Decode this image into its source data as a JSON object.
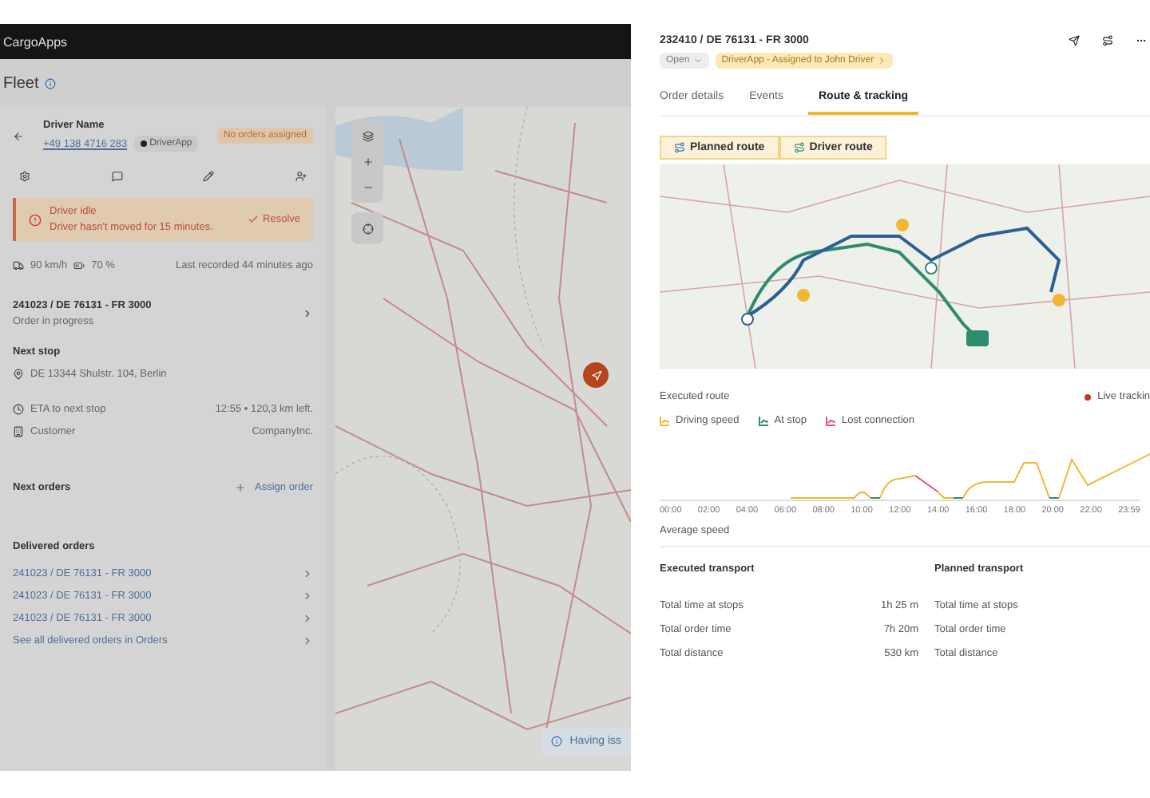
{
  "app": {
    "logo": "CargoApps",
    "page_title": "Fleet"
  },
  "driver": {
    "name": "Driver Name",
    "phone": "+49 138 4716 283",
    "app_badge": "DriverApp",
    "status_badge": "No orders assigned"
  },
  "alert": {
    "title": "Driver idle",
    "message": "Driver hasn't moved for 15 minutes.",
    "action": "Resolve"
  },
  "stats": {
    "speed": "90 km/h",
    "battery": "70 %",
    "last_recorded": "Last recorded 44 minutes ago"
  },
  "current_order": {
    "title": "241023 / DE 76131 - FR 3000",
    "status": "Order in progress"
  },
  "next_stop": {
    "heading": "Next stop",
    "address": "DE 13344 Shulstr. 104, Berlin",
    "details": [
      {
        "kind": "eta",
        "label": "ETA to next stop",
        "value": "12:55 • 120,3 km left."
      },
      {
        "kind": "customer",
        "label": "Customer",
        "value": "CompanyInc."
      }
    ]
  },
  "next_orders": {
    "heading": "Next orders",
    "action": "Assign order"
  },
  "delivered_orders": {
    "heading": "Delivered orders",
    "items": [
      "241023 / DE 76131 - FR 3000",
      "241023 / DE 76131 - FR 3000",
      "241023 / DE 76131 - FR 3000"
    ],
    "see_all": "See all delivered orders in Orders"
  },
  "fleet_map": {
    "toast": "Having iss"
  },
  "order_panel": {
    "title": "232410 / DE 76131 - FR 3000",
    "status": "Open",
    "assignment": "DriverApp - Assigned to John Driver",
    "tabs": [
      {
        "label": "Order details",
        "selected": false
      },
      {
        "label": "Events",
        "selected": false
      },
      {
        "label": "Route & tracking",
        "selected": true
      }
    ],
    "route_buttons": [
      "Planned route",
      "Driver route"
    ],
    "executed_route": {
      "heading": "Executed route",
      "live": "Live trackin",
      "legend": [
        {
          "label": "Driving speed",
          "color": "#f2b632"
        },
        {
          "label": "At stop",
          "color": "#2e8b6e"
        },
        {
          "label": "Lost connection",
          "color": "#d9567a"
        }
      ],
      "time_labels": [
        "00:00",
        "02:00",
        "04:00",
        "06:00",
        "08:00",
        "10:00",
        "12:00",
        "14:00",
        "16:00",
        "18:00",
        "20:00",
        "22:00",
        "23:59"
      ]
    },
    "average_speed": "Average speed",
    "executed_transport": {
      "heading": "Executed transport",
      "rows": [
        {
          "label": "Total time at stops",
          "value": "1h 25 m"
        },
        {
          "label": "Total order time",
          "value": "7h 20m"
        },
        {
          "label": "Total distance",
          "value": "530 km"
        }
      ]
    },
    "planned_transport": {
      "heading": "Planned transport",
      "rows": [
        {
          "label": "Total time at stops"
        },
        {
          "label": "Total order time"
        },
        {
          "label": "Total distance"
        }
      ]
    }
  }
}
